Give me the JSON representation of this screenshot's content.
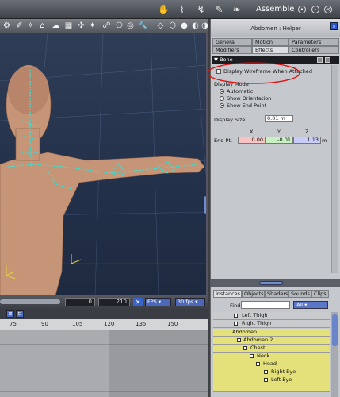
{
  "topbar": {
    "room_title": "Assemble",
    "icons": [
      "hand-icon",
      "deform-icon",
      "pose-icon",
      "walk-icon",
      "morph-icon",
      "material-icon"
    ]
  },
  "toolbar": {
    "icons": [
      "tool-icon-1",
      "tool-icon-2",
      "tool-icon-3",
      "tool-icon-4",
      "tool-icon-5",
      "tool-icon-6",
      "tool-icon-7",
      "tool-icon-8",
      "tool-icon-9",
      "tool-icon-10",
      "tool-icon-11",
      "tool-icon-12",
      "tool-icon-13",
      "tool-icon-14",
      "tool-icon-15",
      "tool-icon-16",
      "tool-icon-17"
    ]
  },
  "panel": {
    "title": "Abdomen : Helper",
    "tabs_row1": [
      "General",
      "Motion",
      "Parameters"
    ],
    "tabs_row2": [
      "Modifiers",
      "Effects",
      "Controllers"
    ],
    "active_tab": "Effects",
    "section_title": "Bone",
    "display_wireframe_label": "Display Wireframe When Attached",
    "display_mode_label": "Display Mode",
    "modes": [
      "Automatic",
      "Show Orientation",
      "Show End Point"
    ],
    "display_size_label": "Display Size",
    "display_size_value": "0.01 m",
    "axis_x": "X",
    "axis_y": "Y",
    "axis_z": "Z",
    "endpt_label": "End Pt.",
    "endpt_x": "0.00",
    "endpt_y": "-0.01",
    "endpt_z": "1.13",
    "endpt_unit": "m",
    "colors": {
      "x": "#f7c3c3",
      "y": "#c9f0c1",
      "z": "#c8cdf7",
      "highlight_circle": "#e01010"
    }
  },
  "library": {
    "tabs": [
      "Instances",
      "Objects",
      "Shaders",
      "Sounds",
      "Clips"
    ],
    "active_tab": "Instances",
    "find_label": "Find:",
    "find_value": "",
    "filter_value": "All",
    "tree": [
      {
        "label": "Left Thigh",
        "style": "plain"
      },
      {
        "label": "Right Thigh",
        "style": "plain"
      },
      {
        "label": "Abdomen",
        "style": "sel"
      },
      {
        "label": "Abdomen 2",
        "style": "sel"
      },
      {
        "label": "Chest",
        "style": "sel"
      },
      {
        "label": "Neck",
        "style": "sel"
      },
      {
        "label": "Head",
        "style": "sel"
      },
      {
        "label": "Right Eye",
        "style": "sel"
      },
      {
        "label": "Left Eye",
        "style": "sel"
      },
      {
        "label": "",
        "style": "sel"
      }
    ]
  },
  "timeline": {
    "current_frame": "0",
    "end_frame": "210",
    "rate_mode": "FPS",
    "rate_value": "30 fps",
    "ruler_ticks": [
      "75",
      "90",
      "105",
      "120",
      "135",
      "150"
    ],
    "playhead_frame": 120
  }
}
